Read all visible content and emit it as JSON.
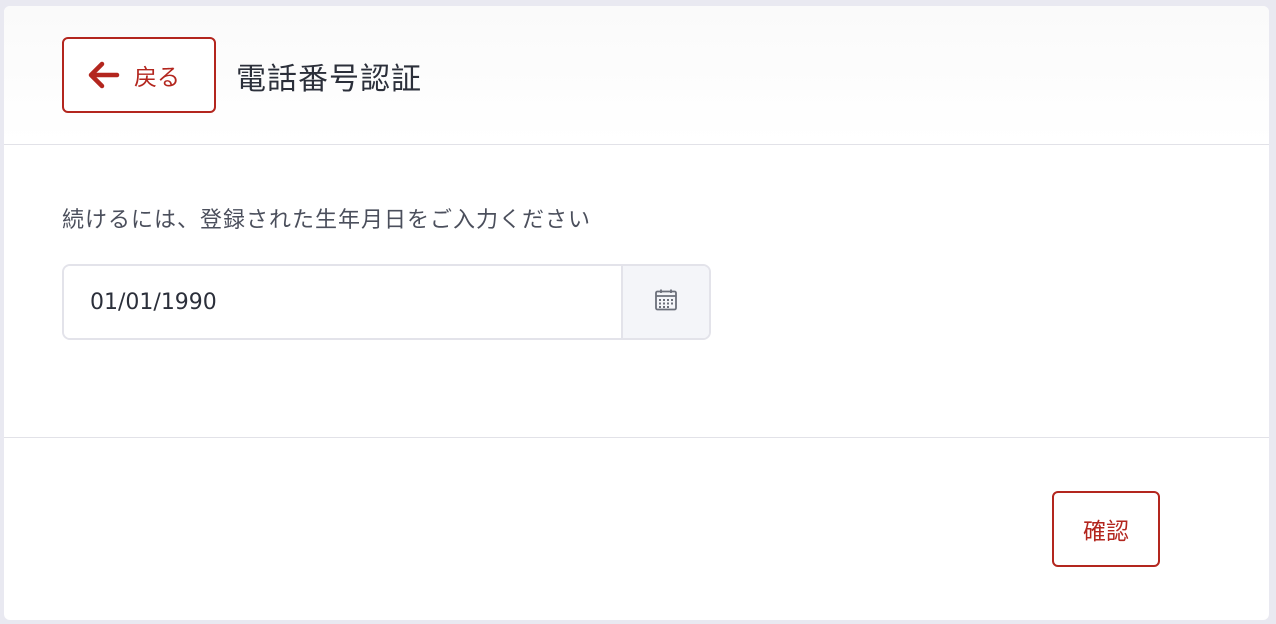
{
  "header": {
    "back_label": "戻る",
    "title": "電話番号認証"
  },
  "form": {
    "instruction": "続けるには、登録された生年月日をご入力ください",
    "date_value": "01/01/1990"
  },
  "footer": {
    "confirm_label": "確認"
  },
  "icons": {
    "back": "arrow-left-icon",
    "calendar": "calendar-icon"
  },
  "colors": {
    "accent": "#b3261e",
    "text": "#2b2f3a",
    "background": "#e9e9f1"
  }
}
